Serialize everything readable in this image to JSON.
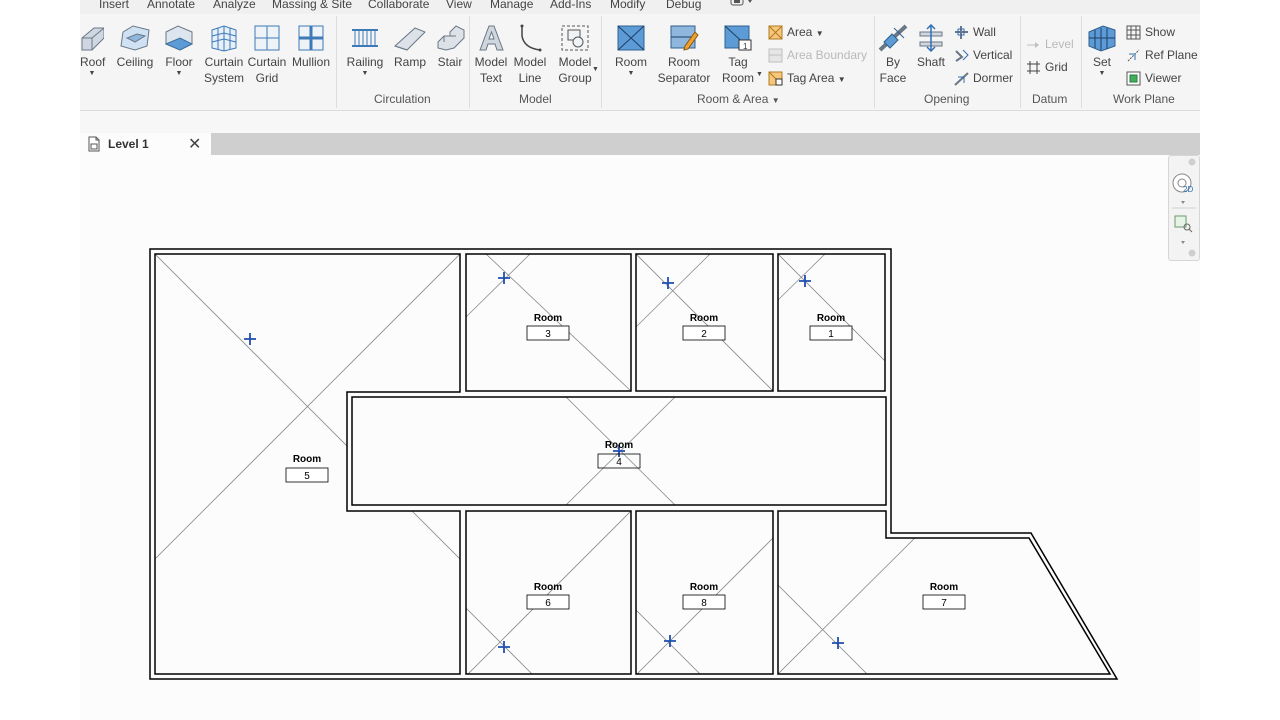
{
  "menu": {
    "tabs": [
      "Insert",
      "Annotate",
      "Analyze",
      "Massing & Site",
      "Collaborate",
      "View",
      "Manage",
      "Add-Ins",
      "Modify",
      "Debug"
    ]
  },
  "ribbon": {
    "build": {
      "roof": "Roof",
      "ceiling": "Ceiling",
      "floor": "Floor",
      "curtain_system": [
        "Curtain",
        "System"
      ],
      "curtain_grid": [
        "Curtain",
        "Grid"
      ],
      "mullion": "Mullion"
    },
    "circulation": {
      "railing": "Railing",
      "ramp": "Ramp",
      "stair": "Stair",
      "label": "Circulation"
    },
    "model": {
      "model_text": [
        "Model",
        "Text"
      ],
      "model_line": [
        "Model",
        "Line"
      ],
      "model_group": [
        "Model",
        "Group"
      ],
      "label": "Model"
    },
    "room_area": {
      "room": "Room",
      "room_separator": [
        "Room",
        "Separator"
      ],
      "tag_room": [
        "Tag",
        "Room"
      ],
      "area": "Area",
      "area_boundary": "Area  Boundary",
      "tag_area": "Tag  Area",
      "label": "Room & Area"
    },
    "opening": {
      "by_face": [
        "By",
        "Face"
      ],
      "shaft": "Shaft",
      "wall": "Wall",
      "vertical": "Vertical",
      "dormer": "Dormer",
      "label": "Opening"
    },
    "datum": {
      "level": "Level",
      "grid": "Grid",
      "label": "Datum"
    },
    "work_plane": {
      "set": "Set",
      "show": "Show",
      "ref_plane": "Ref  Plane",
      "viewer": "Viewer",
      "label": "Work Plane"
    }
  },
  "view_tab": {
    "title": "Level 1",
    "close": "✕"
  },
  "floor_plan": {
    "rooms": [
      {
        "name": "Room",
        "number": "1"
      },
      {
        "name": "Room",
        "number": "2"
      },
      {
        "name": "Room",
        "number": "3"
      },
      {
        "name": "Room",
        "number": "4"
      },
      {
        "name": "Room",
        "number": "5"
      },
      {
        "name": "Room",
        "number": "6"
      },
      {
        "name": "Room",
        "number": "7"
      },
      {
        "name": "Room",
        "number": "8"
      }
    ]
  }
}
